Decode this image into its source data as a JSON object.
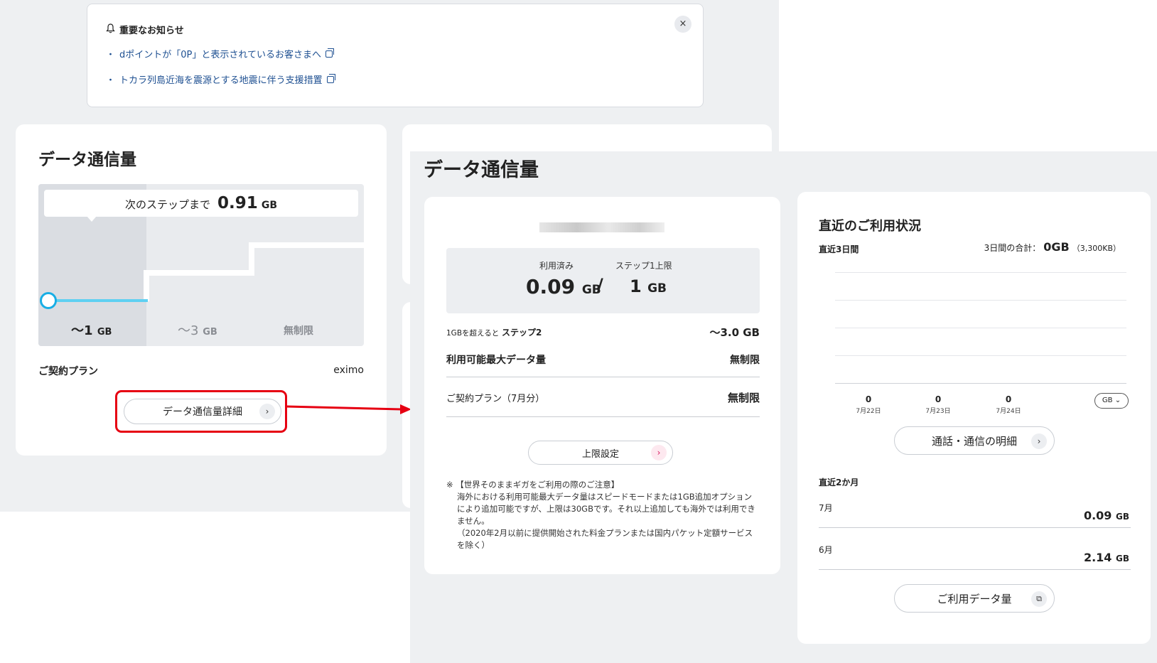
{
  "notice": {
    "title": "重要なお知らせ",
    "links": [
      "dポイントが「0P」と表示されているお客さまへ",
      "トカラ列島近海を震源とする地震に伴う支援措置"
    ],
    "close": "×"
  },
  "left_card": {
    "title": "データ通信量",
    "next_step_label": "次のステップまで",
    "next_step_value": "0.91",
    "next_step_unit": "GB",
    "steps": [
      {
        "label": "〜1",
        "unit": "GB"
      },
      {
        "label": "〜3",
        "unit": "GB"
      },
      {
        "label": "無制限",
        "unit": ""
      }
    ],
    "contract_label": "ご契約プラン",
    "contract_value": "eximo",
    "detail_button": "データ通信量詳細"
  },
  "right_panel": {
    "title": "データ通信量",
    "usage": {
      "used_label": "利用済み",
      "step_limit_label": "ステップ1上限",
      "used_value": "0.09",
      "used_unit": "GB",
      "slash": "/",
      "step_limit_value": "1",
      "step_limit_unit": "GB",
      "exceed_prefix": "1GBを超えると",
      "exceed_step": "ステップ2",
      "exceed_value": "〜3.0 GB",
      "max_label": "利用可能最大データ量",
      "max_value": "無制限",
      "plan_label": "ご契約プラン（7月分）",
      "plan_value": "無制限",
      "limit_button": "上限設定",
      "note_title": "※ 【世界そのままギガをご利用の際のご注意】",
      "note_body": "海外における利用可能最大データ量はスピードモードまたは1GB追加オプションにより追加可能ですが、上限は30GBです。それ以上追加しても海外では利用できません。",
      "note_sub": "（2020年2月以前に提供開始された料金プランまたは国内パケット定額サービスを除く）"
    },
    "recent": {
      "title": "直近のご利用状況",
      "three_days_label": "直近3日間",
      "three_days_total_label": "3日間の合計：",
      "three_days_total_value": "0GB",
      "three_days_total_kb": "（3,300KB）",
      "days": [
        {
          "value": "0",
          "date": "7月22日"
        },
        {
          "value": "0",
          "date": "7月23日"
        },
        {
          "value": "0",
          "date": "7月24日"
        }
      ],
      "unit_select": "GB ⌄",
      "call_detail_button": "通話・通信の明細",
      "two_months_label": "直近2か月",
      "months": [
        {
          "month": "7月",
          "value": "0.09",
          "unit": "GB"
        },
        {
          "month": "6月",
          "value": "2.14",
          "unit": "GB"
        }
      ],
      "data_usage_button": "ご利用データ量"
    }
  },
  "colors": {
    "highlight": "#e60012",
    "step_accent": "#18aee5",
    "link": "#1d4f91"
  }
}
